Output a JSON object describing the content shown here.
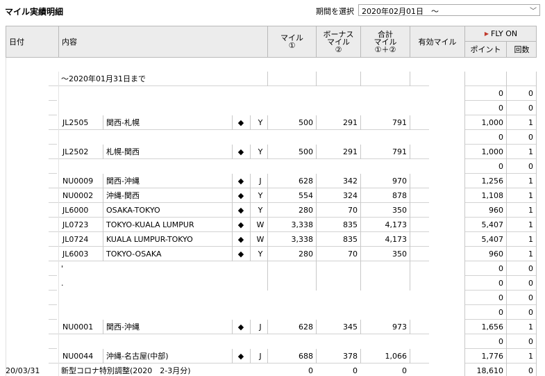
{
  "page_title": "マイル実績明細",
  "period": {
    "label": "期間を選択",
    "value": "2020年02月01日　～"
  },
  "headers": {
    "date": "日付",
    "content": "内容",
    "miles": "マイル",
    "miles_sub": "①",
    "bonus": "ボーナス",
    "bonus2": "マイル",
    "bonus_sub": "②",
    "total": "合計",
    "total2": "マイル",
    "total_sub": "①＋②",
    "valid": "有効マイル",
    "flyon": "FLY ON",
    "points": "ポイント",
    "count": "回数"
  },
  "rows": [
    {
      "content": "～2020年01月31日まで"
    },
    {
      "pts": "0",
      "cnt": "0"
    },
    {
      "pts": "0",
      "cnt": "0"
    },
    {
      "flight": "JL2505",
      "route": "関西-札幌",
      "mark": "◆",
      "cls": "Y",
      "miles": "500",
      "bonus": "291",
      "total": "791",
      "pts": "1,000",
      "cnt": "1"
    },
    {
      "pts": "0",
      "cnt": "0"
    },
    {
      "flight": "JL2502",
      "route": "札幌-関西",
      "mark": "◆",
      "cls": "Y",
      "miles": "500",
      "bonus": "291",
      "total": "791",
      "pts": "1,000",
      "cnt": "1"
    },
    {
      "pts": "0",
      "cnt": "0"
    },
    {
      "flight": "NU0009",
      "route": "関西-沖縄",
      "mark": "◆",
      "cls": "J",
      "miles": "628",
      "bonus": "342",
      "total": "970",
      "pts": "1,256",
      "cnt": "1"
    },
    {
      "flight": "NU0002",
      "route": "沖縄-関西",
      "mark": "◆",
      "cls": "Y",
      "miles": "554",
      "bonus": "324",
      "total": "878",
      "pts": "1,108",
      "cnt": "1"
    },
    {
      "flight": "JL6000",
      "route": "OSAKA-TOKYO",
      "mark": "◆",
      "cls": "Y",
      "miles": "280",
      "bonus": "70",
      "total": "350",
      "pts": "960",
      "cnt": "1"
    },
    {
      "flight": "JL0723",
      "route": "TOKYO-KUALA LUMPUR",
      "mark": "◆",
      "cls": "W",
      "miles": "3,338",
      "bonus": "835",
      "total": "4,173",
      "pts": "5,407",
      "cnt": "1"
    },
    {
      "flight": "JL0724",
      "route": "KUALA LUMPUR-TOKYO",
      "mark": "◆",
      "cls": "W",
      "miles": "3,338",
      "bonus": "835",
      "total": "4,173",
      "pts": "5,407",
      "cnt": "1"
    },
    {
      "flight": "JL6003",
      "route": "TOKYO-OSAKA",
      "mark": "◆",
      "cls": "Y",
      "miles": "280",
      "bonus": "70",
      "total": "350",
      "pts": "960",
      "cnt": "1"
    },
    {
      "content": "'",
      "pts": "0",
      "cnt": "0"
    },
    {
      "content": ".",
      "pts": "0",
      "cnt": "0"
    },
    {
      "pts": "0",
      "cnt": "0"
    },
    {
      "pts": "0",
      "cnt": "0"
    },
    {
      "flight": "NU0001",
      "route": "関西-沖縄",
      "mark": "◆",
      "cls": "J",
      "miles": "628",
      "bonus": "345",
      "total": "973",
      "pts": "1,656",
      "cnt": "1"
    },
    {
      "pts": "0",
      "cnt": "0"
    },
    {
      "flight": "NU0044",
      "route": "沖縄-名古屋(中部)",
      "mark": "◆",
      "cls": "J",
      "miles": "688",
      "bonus": "378",
      "total": "1,066",
      "pts": "1,776",
      "cnt": "1"
    },
    {
      "date": "20/03/31",
      "content": "新型コロナ特別調整(2020　2-3月分)",
      "miles": "0",
      "bonus": "0",
      "total": "0",
      "pts": "18,610",
      "cnt": "0"
    }
  ]
}
